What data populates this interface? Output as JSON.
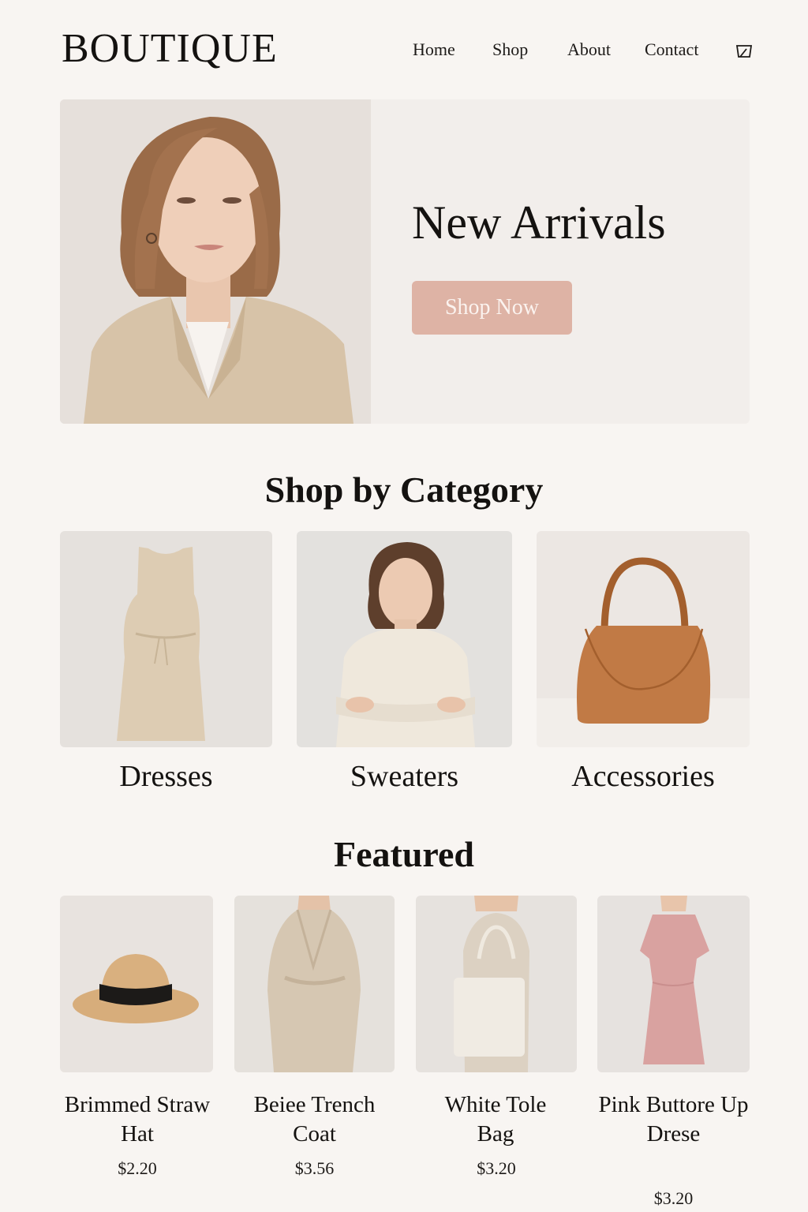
{
  "brand": {
    "logo": "BOUTIQUE"
  },
  "nav": {
    "items": [
      "Home",
      "Shop",
      "About",
      "Contact"
    ],
    "cart_icon": "cart-icon"
  },
  "hero": {
    "title": "New Arrivals",
    "button_label": "Shop Now",
    "button_color": "#deb3a5"
  },
  "categories": {
    "title": "Shop by Category",
    "items": [
      {
        "label": "Dresses",
        "image_icon": "dress-image"
      },
      {
        "label": "Sweaters",
        "image_icon": "sweater-model-image"
      },
      {
        "label": "Accessories",
        "image_icon": "handbag-image"
      }
    ]
  },
  "featured": {
    "title": "Featured",
    "products": [
      {
        "name": "Brimmed Straw Hat",
        "price": "$2.20"
      },
      {
        "name": "Beiee Trench Coat",
        "price": "$3.56"
      },
      {
        "name": "White Tole Bag",
        "price": "$3.20"
      },
      {
        "name": "Pink Buttore Up Drese",
        "price": "$3.20"
      }
    ]
  },
  "colors": {
    "background": "#f8f5f2",
    "accent": "#deb3a5",
    "text": "#141210"
  }
}
